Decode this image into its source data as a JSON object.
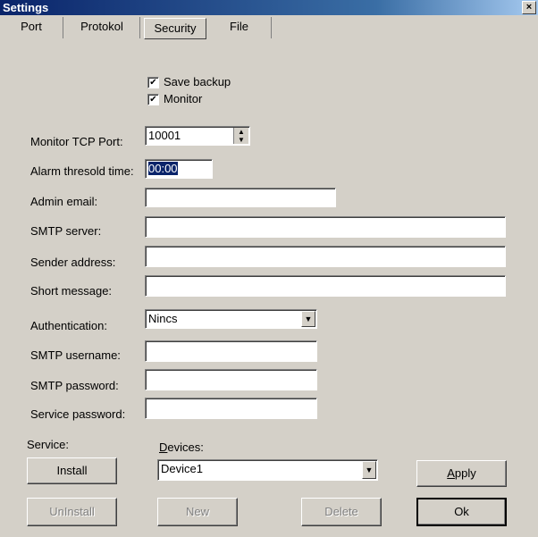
{
  "window": {
    "title": "Settings",
    "close_label": "×"
  },
  "tabs": [
    {
      "label": "Port"
    },
    {
      "label": "Protokol"
    },
    {
      "label": "Security",
      "active": true
    },
    {
      "label": "File"
    }
  ],
  "options": {
    "save_backup": {
      "label": "Save backup",
      "checked": true
    },
    "monitor": {
      "label": "Monitor",
      "checked": true
    }
  },
  "fields": {
    "monitor_tcp_port": {
      "label": "Monitor TCP Port:",
      "value": "10001"
    },
    "alarm_threshold_time": {
      "label": "Alarm thresold time:",
      "value": "00:00"
    },
    "admin_email": {
      "label": "Admin email:",
      "value": ""
    },
    "smtp_server": {
      "label": "SMTP server:",
      "value": ""
    },
    "sender_address": {
      "label": "Sender address:",
      "value": ""
    },
    "short_message": {
      "label": "Short message:",
      "value": ""
    },
    "authentication": {
      "label": "Authentication:",
      "value": "Nincs"
    },
    "smtp_username": {
      "label": "SMTP username:",
      "value": ""
    },
    "smtp_password": {
      "label": "SMTP password:",
      "value": ""
    },
    "service_password": {
      "label": "Service password:",
      "value": ""
    }
  },
  "service": {
    "label": "Service:",
    "install": "Install",
    "uninstall": "UnInstall"
  },
  "devices": {
    "label_rest": "evices:",
    "label_mnemonic": "D",
    "value": "Device1",
    "new": "New",
    "delete": "Delete"
  },
  "buttons": {
    "apply_mnemonic": "A",
    "apply_rest": "pply",
    "ok": "Ok"
  },
  "icons": {
    "check": "✔",
    "spin_up": "▲",
    "spin_down": "▼",
    "dropdown": "▼"
  }
}
